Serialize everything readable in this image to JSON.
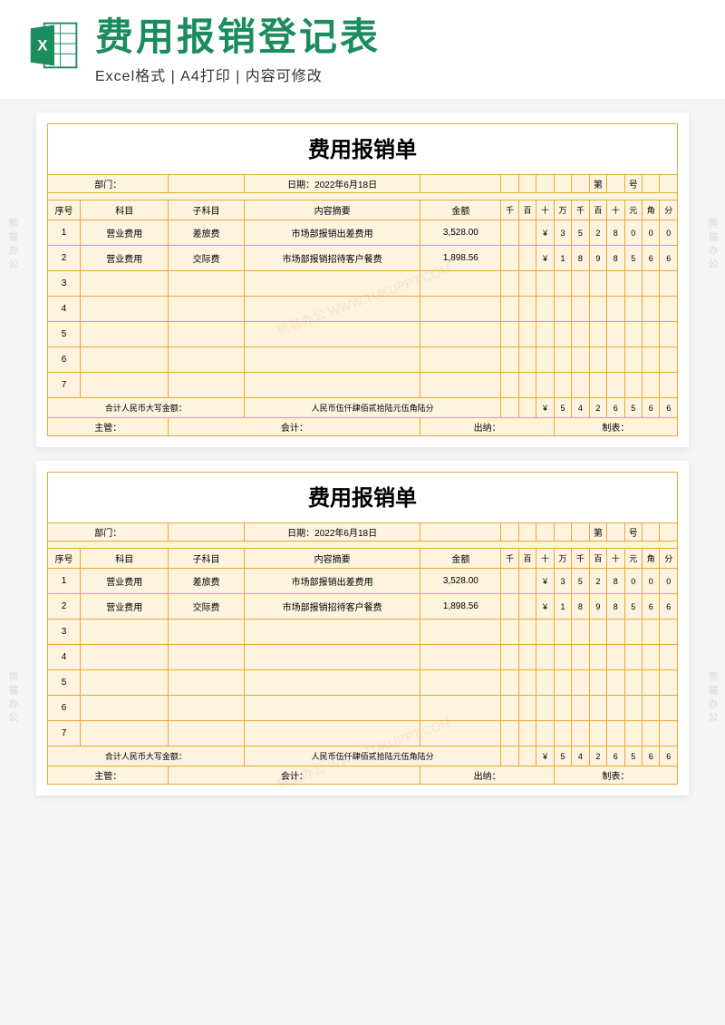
{
  "header": {
    "main_title": "费用报销登记表",
    "sub_title": "Excel格式 | A4打印 | 内容可修改",
    "icon_name": "excel-icon"
  },
  "form": {
    "title": "费用报销单",
    "labels": {
      "dept": "部门：",
      "date_label": "日期：",
      "date_value": "2022年6月18日",
      "seq_prefix": "第",
      "seq_suffix": "号",
      "col_seq": "序号",
      "col_subject": "科目",
      "col_subsubject": "子科目",
      "col_desc": "内容摘要",
      "col_amount": "金额",
      "digit_headers": [
        "千",
        "百",
        "十",
        "万",
        "千",
        "百",
        "十",
        "元",
        "角",
        "分"
      ],
      "total_label": "合计人民币大写金额：",
      "total_text": "人民币伍仟肆佰贰拾陆元伍角陆分",
      "supervisor": "主管：",
      "accountant": "会计：",
      "cashier": "出纳：",
      "preparer": "制表："
    },
    "rows": [
      {
        "seq": "1",
        "subject": "营业费用",
        "subsubject": "差旅费",
        "desc": "市场部报销出差费用",
        "amount": "3,528.00",
        "digits": [
          "",
          "",
          "¥",
          "3",
          "5",
          "2",
          "8",
          "0",
          "0",
          "0"
        ]
      },
      {
        "seq": "2",
        "subject": "营业费用",
        "subsubject": "交际费",
        "desc": "市场部报销招待客户餐费",
        "amount": "1,898.56",
        "digits": [
          "",
          "",
          "¥",
          "1",
          "8",
          "9",
          "8",
          "5",
          "6",
          "6"
        ]
      },
      {
        "seq": "3",
        "subject": "",
        "subsubject": "",
        "desc": "",
        "amount": "",
        "digits": [
          "",
          "",
          "",
          "",
          "",
          "",
          "",
          "",
          "",
          ""
        ]
      },
      {
        "seq": "4",
        "subject": "",
        "subsubject": "",
        "desc": "",
        "amount": "",
        "digits": [
          "",
          "",
          "",
          "",
          "",
          "",
          "",
          "",
          "",
          ""
        ]
      },
      {
        "seq": "5",
        "subject": "",
        "subsubject": "",
        "desc": "",
        "amount": "",
        "digits": [
          "",
          "",
          "",
          "",
          "",
          "",
          "",
          "",
          "",
          ""
        ]
      },
      {
        "seq": "6",
        "subject": "",
        "subsubject": "",
        "desc": "",
        "amount": "",
        "digits": [
          "",
          "",
          "",
          "",
          "",
          "",
          "",
          "",
          "",
          ""
        ]
      },
      {
        "seq": "7",
        "subject": "",
        "subsubject": "",
        "desc": "",
        "amount": "",
        "digits": [
          "",
          "",
          "",
          "",
          "",
          "",
          "",
          "",
          "",
          ""
        ]
      }
    ],
    "total_digits": [
      "",
      "",
      "¥",
      "5",
      "4",
      "2",
      "6",
      "5",
      "6",
      "6"
    ]
  },
  "watermark": {
    "side": "熊猫办公",
    "diag": "熊猫办公 WWW.TUKUPPT.COM"
  }
}
